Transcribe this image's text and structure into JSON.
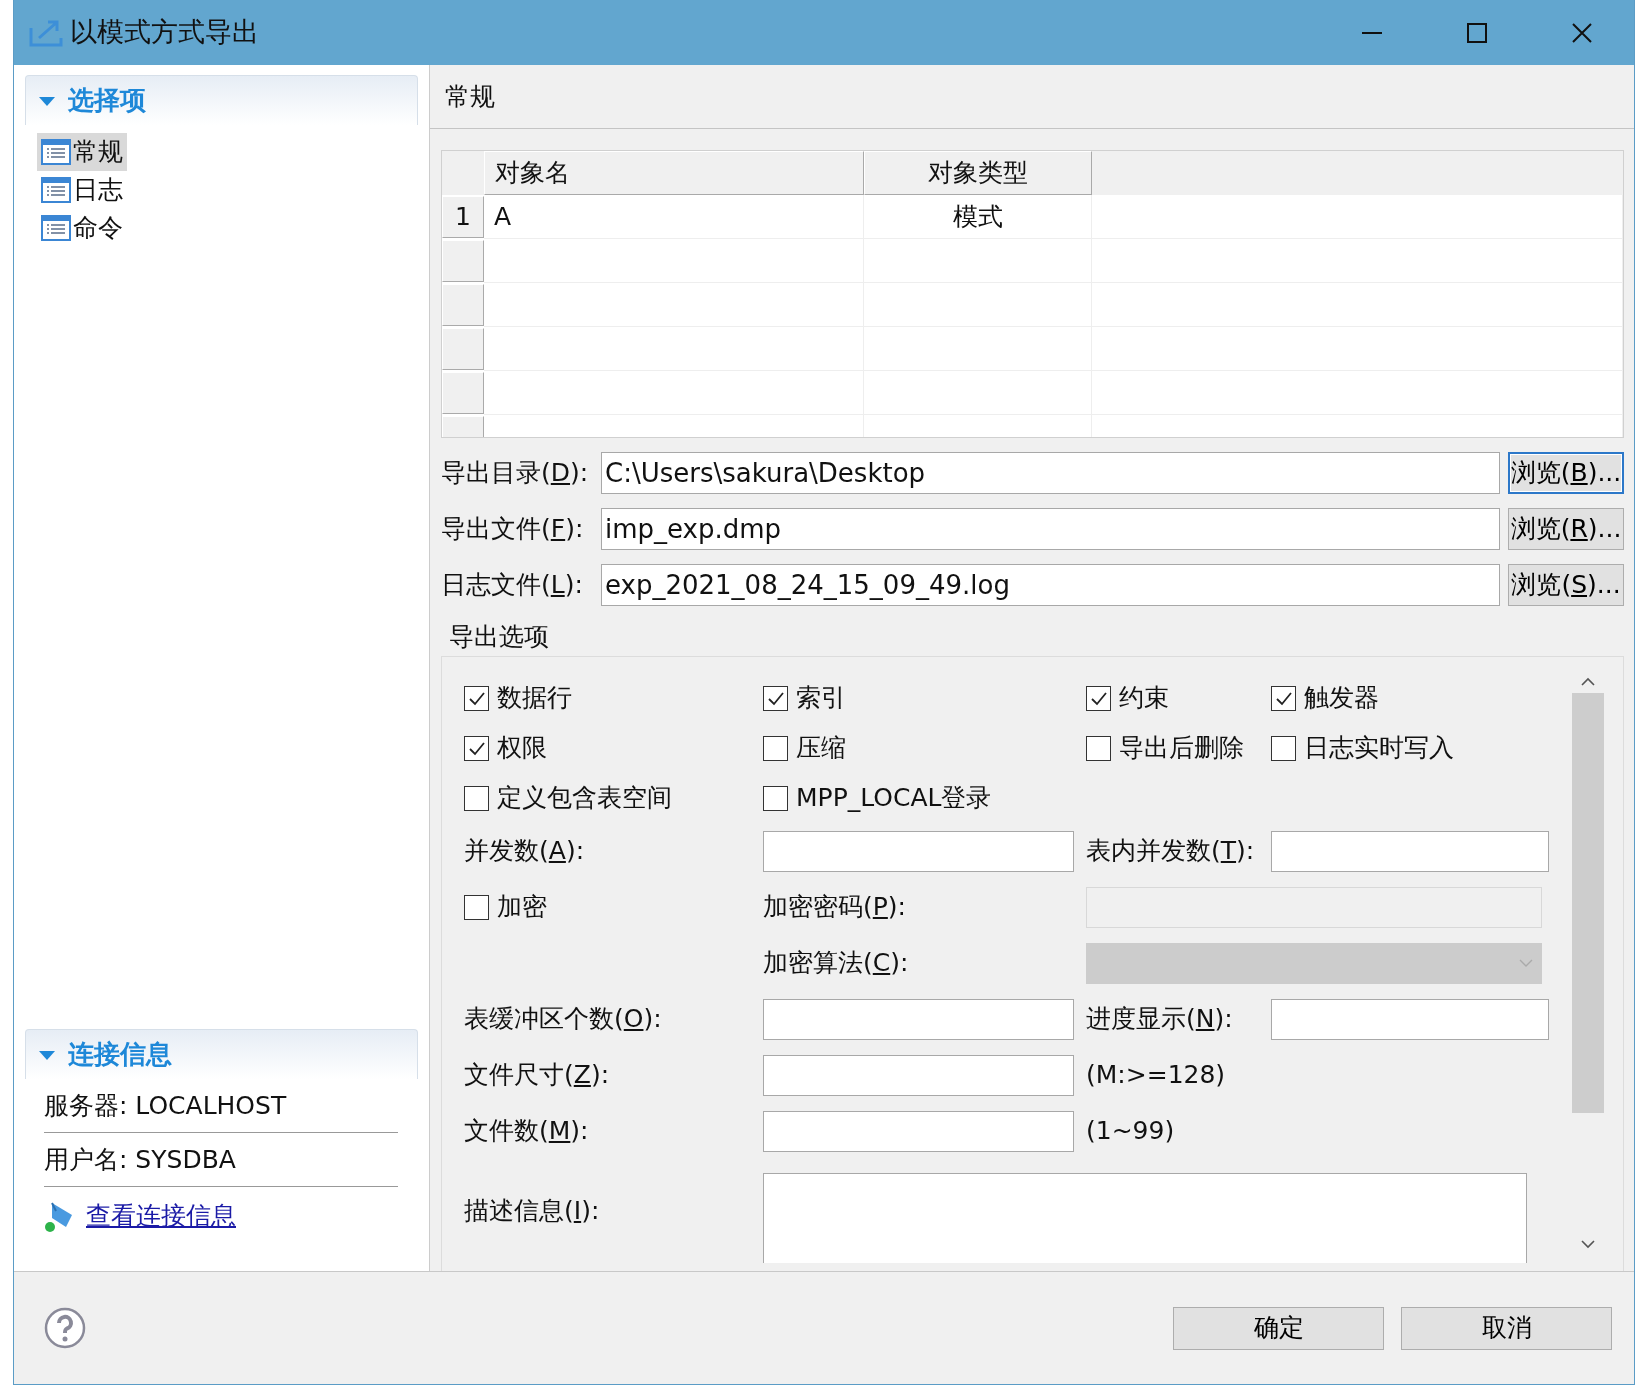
{
  "window": {
    "title": "以模式方式导出"
  },
  "sidebar": {
    "sections": [
      {
        "kind": "tree",
        "title": "选择项",
        "expanded": true,
        "items": [
          {
            "label": "常规",
            "selected": true
          },
          {
            "label": "日志",
            "selected": false
          },
          {
            "label": "命令",
            "selected": false
          }
        ]
      },
      {
        "kind": "info",
        "title": "连接信息",
        "expanded": true,
        "lines": [
          "服务器: LOCALHOST",
          "用户名: SYSDBA"
        ],
        "link": "查看连接信息"
      }
    ]
  },
  "page": {
    "title": "常规",
    "table": {
      "columns": [
        "对象名",
        "对象类型"
      ],
      "rows": [
        {
          "number": "1",
          "cells": [
            "A",
            "模式"
          ]
        }
      ]
    },
    "paths": [
      {
        "label": "导出目录(D):",
        "value": "C:\\Users\\sakura\\Desktop",
        "button": "浏览(B)...",
        "focused": true
      },
      {
        "label": "导出文件(F):",
        "value": "imp_exp.dmp",
        "button": "浏览(R)...",
        "focused": false
      },
      {
        "label": "日志文件(L):",
        "value": "exp_2021_08_24_15_09_49.log",
        "button": "浏览(S)...",
        "focused": false
      }
    ],
    "options": {
      "title": "导出选项",
      "rows": [
        [
          {
            "kind": "checkbox",
            "label": "数据行",
            "checked": true
          },
          {
            "kind": "checkbox",
            "label": "索引",
            "checked": true
          },
          {
            "kind": "checkbox",
            "label": "约束",
            "checked": true
          },
          {
            "kind": "checkbox",
            "label": "触发器",
            "checked": true
          }
        ],
        [
          {
            "kind": "checkbox",
            "label": "权限",
            "checked": true
          },
          {
            "kind": "checkbox",
            "label": "压缩",
            "checked": false
          },
          {
            "kind": "checkbox",
            "label": "导出后删除",
            "checked": false
          },
          {
            "kind": "checkbox",
            "label": "日志实时写入",
            "checked": false
          }
        ],
        [
          {
            "kind": "checkbox",
            "label": "定义包含表空间",
            "checked": false
          },
          {
            "kind": "checkbox",
            "label": "MPP_LOCAL登录",
            "checked": false
          }
        ],
        [
          {
            "kind": "label",
            "text": "并发数(A):"
          },
          {
            "kind": "input",
            "disabled": false
          },
          {
            "kind": "label",
            "text": "表内并发数(T):"
          },
          {
            "kind": "input",
            "disabled": false
          }
        ],
        [
          {
            "kind": "checkbox",
            "label": "加密",
            "checked": false
          },
          {
            "kind": "label",
            "text": "加密密码(P):"
          },
          {
            "kind": "input",
            "disabled": true
          }
        ],
        [
          {
            "kind": "blank"
          },
          {
            "kind": "label",
            "text": "加密算法(C):"
          },
          {
            "kind": "select",
            "disabled": true
          }
        ],
        [
          {
            "kind": "label",
            "text": "表缓冲区个数(O):"
          },
          {
            "kind": "input",
            "disabled": false
          },
          {
            "kind": "label",
            "text": "进度显示(N):"
          },
          {
            "kind": "input",
            "disabled": false
          }
        ],
        [
          {
            "kind": "label",
            "text": "文件尺寸(Z):"
          },
          {
            "kind": "input",
            "disabled": false
          },
          {
            "kind": "note",
            "text": "(M:>=128)"
          }
        ],
        [
          {
            "kind": "label",
            "text": "文件数(M):"
          },
          {
            "kind": "input",
            "disabled": false
          },
          {
            "kind": "note",
            "text": "(1~99)"
          }
        ],
        [
          {
            "kind": "label",
            "text": "描述信息(I):"
          },
          {
            "kind": "textarea"
          }
        ]
      ]
    }
  },
  "buttons": [
    {
      "label": "确定"
    },
    {
      "label": "取消"
    }
  ]
}
